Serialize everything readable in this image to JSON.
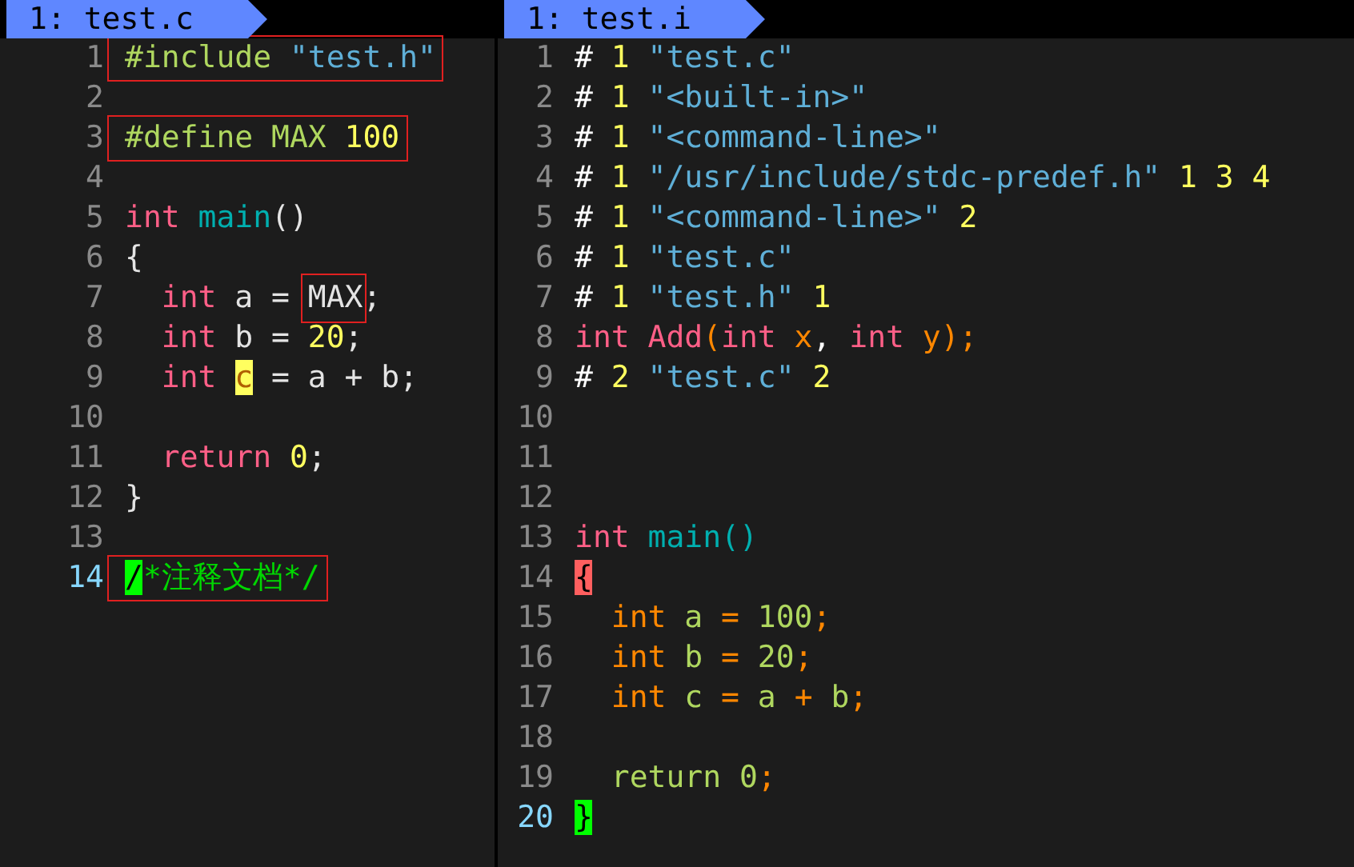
{
  "panes": [
    {
      "tab": "1: test.c",
      "lines": [
        {
          "number": "1",
          "current": false,
          "boxed": true,
          "tokens": [
            {
              "text": "#include ",
              "color": "#afd75f"
            },
            {
              "text": "\"test.h\"",
              "color": "#5fafd7"
            }
          ]
        },
        {
          "number": "2",
          "current": false,
          "boxed": false
        },
        {
          "number": "3",
          "current": false,
          "boxed": true,
          "tokens": [
            {
              "text": "#define MAX ",
              "color": "#afd75f"
            },
            {
              "text": "100",
              "color": "#ffff5f"
            }
          ]
        },
        {
          "number": "4",
          "current": false,
          "boxed": false
        },
        {
          "number": "5",
          "current": false,
          "boxed": false,
          "tokens": [
            {
              "text": "int",
              "color": "#ff5f87"
            },
            {
              "text": " main",
              "color": "#00afaf"
            },
            {
              "text": "()",
              "color": "#e4e4e4"
            }
          ]
        },
        {
          "number": "6",
          "current": false,
          "boxed": false,
          "tokens": [
            {
              "text": "{",
              "color": "#e4e4e4"
            }
          ]
        },
        {
          "number": "7",
          "current": false,
          "boxed": false,
          "tokens": [
            {
              "text": "  int",
              "color": "#ff5f87"
            },
            {
              "text": " a = ",
              "color": "#e4e4e4"
            },
            {
              "text": "MAX",
              "color": "#e4e4e4",
              "boxed": true
            },
            {
              "text": ";",
              "color": "#e4e4e4"
            }
          ]
        },
        {
          "number": "8",
          "current": false,
          "boxed": false,
          "tokens": [
            {
              "text": "  int",
              "color": "#ff5f87"
            },
            {
              "text": " b = ",
              "color": "#e4e4e4"
            },
            {
              "text": "20",
              "color": "#ffff5f"
            },
            {
              "text": ";",
              "color": "#e4e4e4"
            }
          ]
        },
        {
          "number": "9",
          "current": false,
          "boxed": false,
          "tokens": [
            {
              "text": "  int ",
              "color": "#ff5f87"
            },
            {
              "text": "c",
              "color": "#ffff5f",
              "kind": "match"
            },
            {
              "text": " = a + b;",
              "color": "#e4e4e4"
            }
          ]
        },
        {
          "number": "10",
          "current": false,
          "boxed": false
        },
        {
          "number": "11",
          "current": false,
          "boxed": false,
          "tokens": [
            {
              "text": "  return ",
              "color": "#ff5f87"
            },
            {
              "text": "0",
              "color": "#ffff5f"
            },
            {
              "text": ";",
              "color": "#e4e4e4"
            }
          ]
        },
        {
          "number": "12",
          "current": false,
          "boxed": false,
          "tokens": [
            {
              "text": "}",
              "color": "#e4e4e4"
            }
          ]
        },
        {
          "number": "13",
          "current": false,
          "boxed": false
        },
        {
          "number": "14",
          "current": true,
          "boxed": true,
          "tokens": [
            {
              "text": "/",
              "color": "#00ff00",
              "kind": "cursor"
            },
            {
              "text": "*注释文档*/",
              "color": "#00d700"
            }
          ]
        }
      ]
    },
    {
      "tab": "1: test.i",
      "lines": [
        {
          "number": "1",
          "current": false,
          "boxed": false,
          "tokens": [
            {
              "text": "# ",
              "color": "#ffffff"
            },
            {
              "text": "1",
              "color": "#ffff5f"
            },
            {
              "text": " \"test.c\"",
              "color": "#5fafd7"
            }
          ]
        },
        {
          "number": "2",
          "current": false,
          "boxed": false,
          "tokens": [
            {
              "text": "# ",
              "color": "#ffffff"
            },
            {
              "text": "1",
              "color": "#ffff5f"
            },
            {
              "text": " \"<built-in>\"",
              "color": "#5fafd7"
            }
          ]
        },
        {
          "number": "3",
          "current": false,
          "boxed": false,
          "tokens": [
            {
              "text": "# ",
              "color": "#ffffff"
            },
            {
              "text": "1",
              "color": "#ffff5f"
            },
            {
              "text": " \"<command-line>\"",
              "color": "#5fafd7"
            }
          ]
        },
        {
          "number": "4",
          "current": false,
          "boxed": false,
          "tokens": [
            {
              "text": "# ",
              "color": "#ffffff"
            },
            {
              "text": "1",
              "color": "#ffff5f"
            },
            {
              "text": " \"/usr/include/stdc-predef.h\"",
              "color": "#5fafd7"
            },
            {
              "text": " 1 3 4",
              "color": "#ffff5f"
            }
          ]
        },
        {
          "number": "5",
          "current": false,
          "boxed": false,
          "tokens": [
            {
              "text": "# ",
              "color": "#ffffff"
            },
            {
              "text": "1",
              "color": "#ffff5f"
            },
            {
              "text": " \"<command-line>\"",
              "color": "#5fafd7"
            },
            {
              "text": " 2",
              "color": "#ffff5f"
            }
          ]
        },
        {
          "number": "6",
          "current": false,
          "boxed": false,
          "tokens": [
            {
              "text": "# ",
              "color": "#ffffff"
            },
            {
              "text": "1",
              "color": "#ffff5f"
            },
            {
              "text": " \"test.c\"",
              "color": "#5fafd7"
            }
          ]
        },
        {
          "number": "7",
          "current": false,
          "boxed": false,
          "tokens": [
            {
              "text": "# ",
              "color": "#ffffff"
            },
            {
              "text": "1",
              "color": "#ffff5f"
            },
            {
              "text": " \"test.h\"",
              "color": "#5fafd7"
            },
            {
              "text": " 1",
              "color": "#ffff5f"
            }
          ]
        },
        {
          "number": "8",
          "current": false,
          "boxed": false,
          "tokens": [
            {
              "text": "int Add",
              "color": "#ff5f87"
            },
            {
              "text": "(",
              "color": "#ff8700"
            },
            {
              "text": "int",
              "color": "#ff5f87"
            },
            {
              "text": " x",
              "color": "#ff8700"
            },
            {
              "text": ", ",
              "color": "#ffffff"
            },
            {
              "text": "int",
              "color": "#ff5f87"
            },
            {
              "text": " y);",
              "color": "#ff8700"
            }
          ]
        },
        {
          "number": "9",
          "current": false,
          "boxed": false,
          "tokens": [
            {
              "text": "# ",
              "color": "#ffffff"
            },
            {
              "text": "2",
              "color": "#ffff5f"
            },
            {
              "text": " \"test.c\"",
              "color": "#5fafd7"
            },
            {
              "text": " 2",
              "color": "#ffff5f"
            }
          ]
        },
        {
          "number": "10",
          "current": false,
          "boxed": false
        },
        {
          "number": "11",
          "current": false,
          "boxed": false
        },
        {
          "number": "12",
          "current": false,
          "boxed": false
        },
        {
          "number": "13",
          "current": false,
          "boxed": false,
          "tokens": [
            {
              "text": "int",
              "color": "#ff5f87"
            },
            {
              "text": " main()",
              "color": "#00afaf"
            }
          ]
        },
        {
          "number": "14",
          "current": false,
          "boxed": false,
          "tokens": [
            {
              "text": "{",
              "color": "#ff5f5f",
              "kind": "paren"
            }
          ]
        },
        {
          "number": "15",
          "current": false,
          "boxed": false,
          "tokens": [
            {
              "text": "  int",
              "color": "#ff8700"
            },
            {
              "text": " a ",
              "color": "#afd75f"
            },
            {
              "text": "=",
              "color": "#ff8700"
            },
            {
              "text": " 100",
              "color": "#afd75f"
            },
            {
              "text": ";",
              "color": "#ff8700"
            }
          ]
        },
        {
          "number": "16",
          "current": false,
          "boxed": false,
          "tokens": [
            {
              "text": "  int",
              "color": "#ff8700"
            },
            {
              "text": " b ",
              "color": "#afd75f"
            },
            {
              "text": "=",
              "color": "#ff8700"
            },
            {
              "text": " 20",
              "color": "#afd75f"
            },
            {
              "text": ";",
              "color": "#ff8700"
            }
          ]
        },
        {
          "number": "17",
          "current": false,
          "boxed": false,
          "tokens": [
            {
              "text": "  int",
              "color": "#ff8700"
            },
            {
              "text": " c ",
              "color": "#afd75f"
            },
            {
              "text": "=",
              "color": "#ff8700"
            },
            {
              "text": " a ",
              "color": "#afd75f"
            },
            {
              "text": "+",
              "color": "#ff8700"
            },
            {
              "text": " b",
              "color": "#afd75f"
            },
            {
              "text": ";",
              "color": "#ff8700"
            }
          ]
        },
        {
          "number": "18",
          "current": false,
          "boxed": false
        },
        {
          "number": "19",
          "current": false,
          "boxed": false,
          "tokens": [
            {
              "text": "  return 0",
              "color": "#afd75f"
            },
            {
              "text": ";",
              "color": "#ff8700"
            }
          ]
        },
        {
          "number": "20",
          "current": true,
          "boxed": false,
          "tokens": [
            {
              "text": "}",
              "color": "#00ff00",
              "kind": "cursor"
            }
          ]
        }
      ]
    }
  ]
}
